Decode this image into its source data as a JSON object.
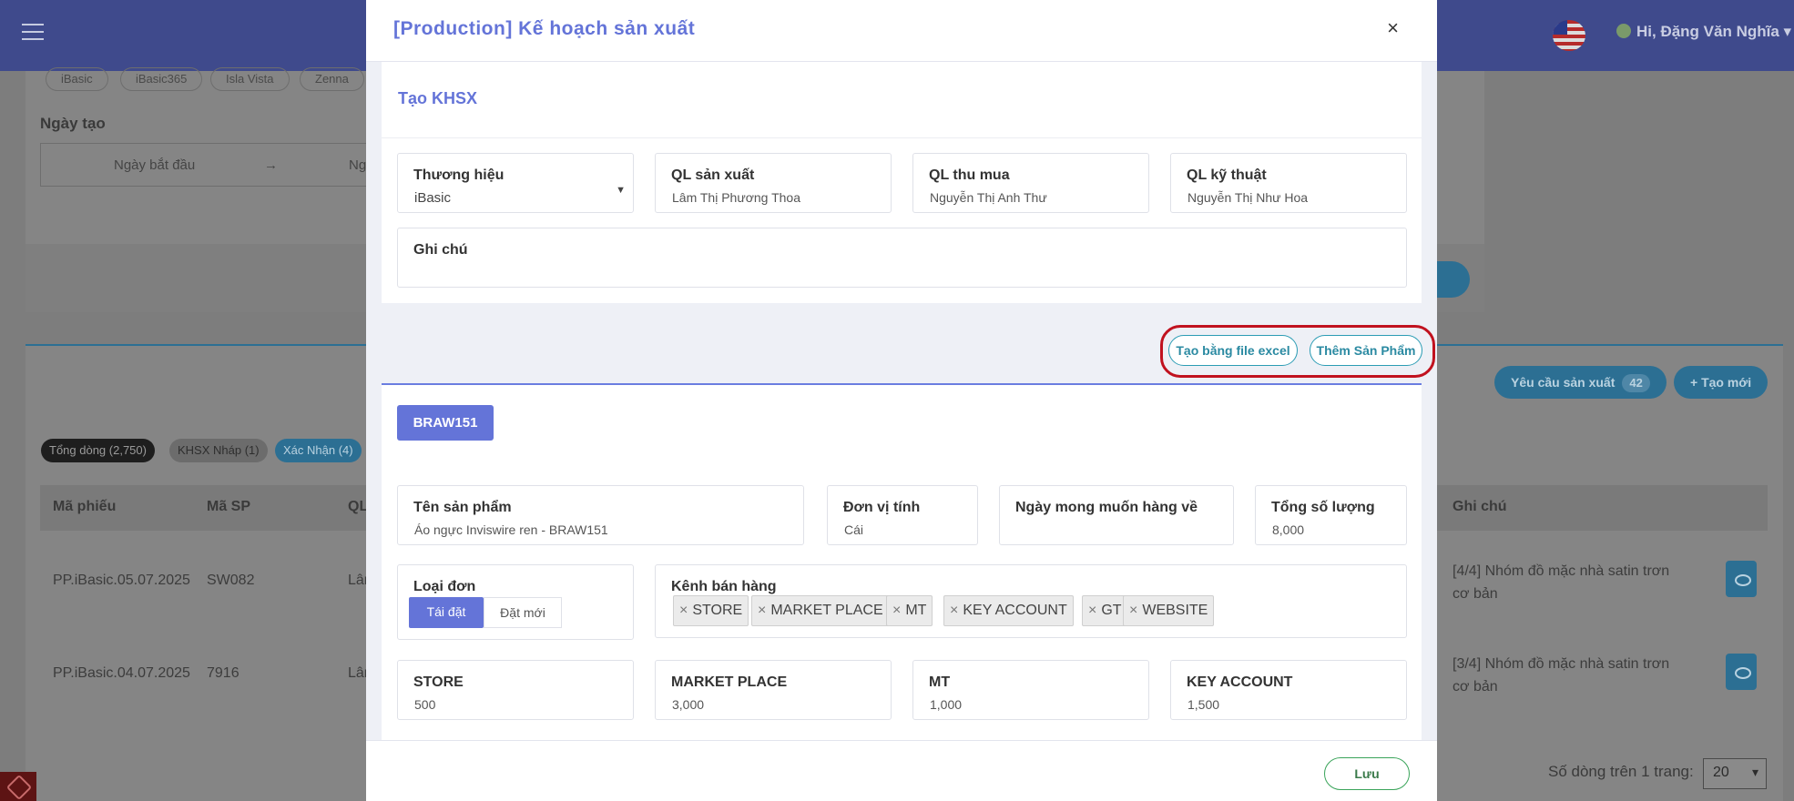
{
  "background": {
    "user_greeting": "Hi, Đặng Văn Nghĩa",
    "brand_chips": [
      "iBasic",
      "iBasic365",
      "Isla Vista",
      "Zenna"
    ],
    "date_filter_label": "Ngày tạo",
    "date_start_placeholder": "Ngày bắt đầu",
    "date_arrow": "→",
    "date_end_placeholder": "Ng",
    "status_tabs": [
      "Tổng dòng (2,750)",
      "KHSX Nháp (1)",
      "Xác Nhận (4)"
    ],
    "request_button": "Yêu cầu sản xuất",
    "request_count": "42",
    "create_new_button": "+ Tạo mới",
    "table_headers": [
      "Mã phiếu",
      "Mã SP",
      "QL",
      "Ghi chú"
    ],
    "rows": [
      {
        "code": "PP.iBasic.05.07.2025",
        "sku": "SW082",
        "ql": "Lân",
        "note": "[4/4] Nhóm đồ mặc nhà satin trơn cơ bản"
      },
      {
        "code": "PP.iBasic.04.07.2025",
        "sku": "7916",
        "ql": "Lân",
        "note": "[3/4] Nhóm đồ mặc nhà satin trơn cơ bản"
      }
    ],
    "rows_per_page_label": "Số dòng trên 1 trang:",
    "rows_per_page_value": "20"
  },
  "modal": {
    "title": "[Production] Kế hoạch sản xuất",
    "close": "×",
    "section_title": "Tạo KHSX",
    "fields": {
      "brand": {
        "label": "Thương hiệu",
        "value": "iBasic"
      },
      "production_manager": {
        "label": "QL sản xuất",
        "value": "Lâm Thị Phương Thoa"
      },
      "purchasing_manager": {
        "label": "QL thu mua",
        "value": "Nguyễn Thị Anh Thư"
      },
      "technical_manager": {
        "label": "QL kỹ thuật",
        "value": "Nguyễn Thị Như Hoa"
      },
      "note": {
        "label": "Ghi chú",
        "value": ""
      }
    },
    "excel_button": "Tạo bằng file excel",
    "add_product_button": "Thêm Sản Phẩm",
    "product": {
      "code": "BRAW151",
      "name_label": "Tên sản phẩm",
      "name_value": "Áo ngực Inviswire ren - BRAW151",
      "unit_label": "Đơn vị tính",
      "unit_value": "Cái",
      "desired_date_label": "Ngày mong muốn hàng về",
      "desired_date_value": "",
      "total_label": "Tổng số lượng",
      "total_value": "8,000",
      "order_type_label": "Loại đơn",
      "order_type_options": [
        "Tái đặt",
        "Đặt mới"
      ],
      "order_type_selected": "Tái đặt",
      "channel_label": "Kênh bán hàng",
      "channels": [
        "STORE",
        "MARKET PLACE",
        "MT",
        "KEY ACCOUNT",
        "GT",
        "WEBSITE"
      ],
      "quantities": [
        {
          "label": "STORE",
          "value": "500"
        },
        {
          "label": "MARKET PLACE",
          "value": "3,000"
        },
        {
          "label": "MT",
          "value": "1,000"
        },
        {
          "label": "KEY ACCOUNT",
          "value": "1,500"
        }
      ]
    },
    "save_button": "Lưu"
  },
  "colors": {
    "accent": "#6474d8",
    "teal": "#2b9cb4",
    "highlight": "#c1121f",
    "save": "#3aa45a"
  },
  "icons": [
    "menu-icon",
    "us-flag-icon",
    "user-avatar-icon",
    "close-icon",
    "caret-down-icon",
    "remove-tag-icon",
    "eye-icon",
    "laravel-logo-icon"
  ]
}
